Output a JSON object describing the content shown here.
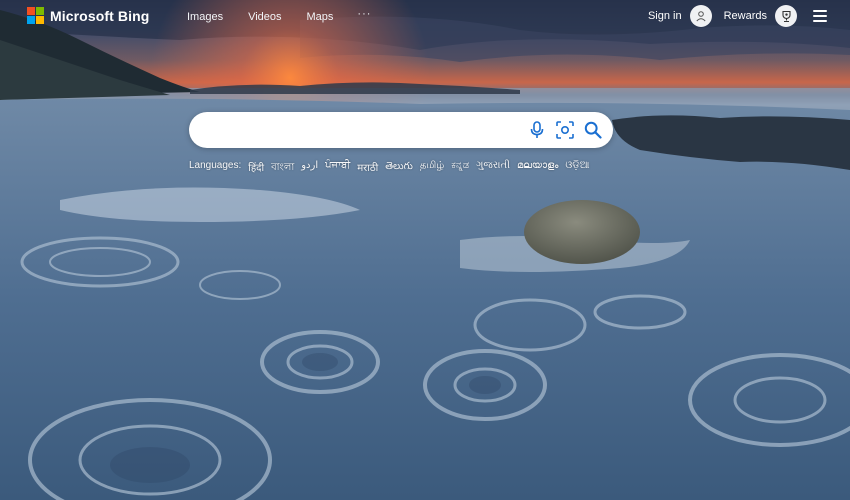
{
  "header": {
    "brand": "Microsoft Bing",
    "nav": {
      "images": "Images",
      "videos": "Videos",
      "maps": "Maps",
      "more": "···"
    },
    "signin_label": "Sign in",
    "rewards_label": "Rewards"
  },
  "colors": {
    "ms_red": "#f25022",
    "ms_green": "#7fba00",
    "ms_blue": "#00a4ef",
    "ms_yellow": "#ffb900"
  },
  "icons": {
    "signin": "person-icon",
    "rewards": "trophy-icon",
    "menu": "hamburger-icon",
    "mic": "microphone-icon",
    "visual_search": "camera-search-icon",
    "search": "search-icon"
  },
  "search": {
    "value": "",
    "placeholder": ""
  },
  "languages": {
    "label": "Languages:",
    "items": [
      "हिंदी",
      "বাংলা",
      "اردو",
      "ਪੰਜਾਬੀ",
      "मराठी",
      "తెలుగు",
      "தமிழ்",
      "ಕನ್ನಡ",
      "ગુજરાતી",
      "മലയാളം",
      "ଓଡ଼ିଆ"
    ]
  }
}
